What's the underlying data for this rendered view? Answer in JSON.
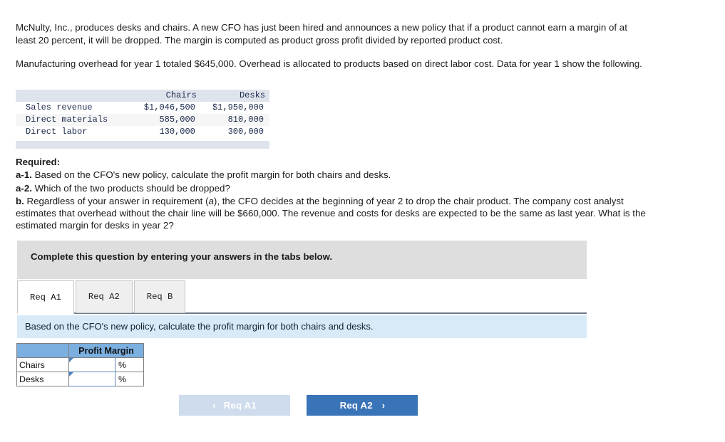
{
  "problem": {
    "paragraph1": "McNulty, Inc., produces desks and chairs. A new CFO has just been hired and announces a new policy that if a product cannot earn a margin of at least 20 percent, it will be dropped. The margin is computed as product gross profit divided by reported product cost.",
    "paragraph2": "Manufacturing overhead for year 1 totaled $645,000. Overhead is allocated to products based on direct labor cost. Data for year 1 show the following."
  },
  "data_table": {
    "columns": [
      "",
      "Chairs",
      "Desks"
    ],
    "rows": [
      {
        "label": "Sales revenue",
        "chairs": "$1,046,500",
        "desks": "$1,950,000"
      },
      {
        "label": "Direct materials",
        "chairs": "585,000",
        "desks": "810,000"
      },
      {
        "label": "Direct labor",
        "chairs": "130,000",
        "desks": "300,000"
      }
    ]
  },
  "required": {
    "heading": "Required:",
    "a1_label": "a-1.",
    "a1_text": " Based on the CFO's new policy, calculate the profit margin for both chairs and desks.",
    "a2_label": "a-2.",
    "a2_text": " Which of the two products should be dropped?",
    "b_label": "b.",
    "b_text_part1": " Regardless of your answer in requirement (",
    "b_text_italic": "a",
    "b_text_part2": "), the CFO decides at the beginning of year 2 to drop the chair product. The company cost analyst estimates that overhead without the chair line will be $660,000. The revenue and costs for desks are expected to be the same as last year. What is the estimated margin for desks in year 2?"
  },
  "banner": {
    "instruction": "Complete this question by entering your answers in the tabs below."
  },
  "tabs": {
    "items": [
      {
        "label": "Req A1",
        "active": true
      },
      {
        "label": "Req A2",
        "active": false
      },
      {
        "label": "Req B",
        "active": false
      }
    ]
  },
  "sub_instruction": {
    "text": "Based on the CFO's new policy, calculate the profit margin for both chairs and desks."
  },
  "answer_table": {
    "corner_header": "",
    "column_header": "Profit Margin",
    "rows": [
      {
        "label": "Chairs",
        "value": "",
        "unit": "%"
      },
      {
        "label": "Desks",
        "value": "",
        "unit": "%"
      }
    ]
  },
  "nav": {
    "prev_label": "Req A1",
    "prev_chevron": "‹",
    "next_label": "Req A2",
    "next_chevron": "›"
  },
  "colors": {
    "accent_blue": "#3a74b8",
    "header_blue": "#7bafe0",
    "banner_gray": "#dedede",
    "banner_blue": "#d8eaf8",
    "prev_button": "#cfdced"
  }
}
